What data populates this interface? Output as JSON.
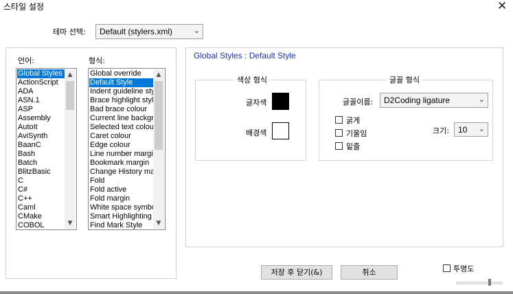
{
  "window": {
    "title": "스타일 설정",
    "close_glyph": "✕"
  },
  "theme": {
    "label": "테마 선택:",
    "value": "Default (stylers.xml)"
  },
  "languages": {
    "label": "언어:",
    "items": [
      "Global Styles",
      "ActionScript",
      "ADA",
      "ASN.1",
      "ASP",
      "Assembly",
      "AutoIt",
      "AviSynth",
      "BaanC",
      "Bash",
      "Batch",
      "BlitzBasic",
      "C",
      "C#",
      "C++",
      "Caml",
      "CMake",
      "COBOL"
    ],
    "selected_index": 0
  },
  "styles": {
    "label": "형식:",
    "items": [
      "Global override",
      "Default Style",
      "Indent guideline style",
      "Brace highlight style",
      "Bad brace colour",
      "Current line background colour",
      "Selected text colour",
      "Caret colour",
      "Edge colour",
      "Line number margin",
      "Bookmark margin",
      "Change History margin",
      "Fold",
      "Fold active",
      "Fold margin",
      "White space symbol",
      "Smart Highlighting",
      "Find Mark Style"
    ],
    "selected_index": 1
  },
  "detail": {
    "heading": "Global Styles : Default Style",
    "colour_group": {
      "title": "색상 형식",
      "fg_label": "글자색",
      "bg_label": "배경색",
      "fg_color": "#000000",
      "bg_color": "#ffffff"
    },
    "font_group": {
      "title": "글꼴 형식",
      "name_label": "글꼴이름:",
      "name_value": "D2Coding ligature",
      "bold_label": "굵게",
      "italic_label": "기울임",
      "underline_label": "밑줄",
      "size_label": "크기:",
      "size_value": "10"
    }
  },
  "buttons": {
    "save_close": "저장 후 닫기(&)",
    "cancel": "취소"
  },
  "transparency": {
    "label": "투명도"
  },
  "colors": {
    "selection": "#0078d7",
    "heading": "#1c2fb8"
  }
}
